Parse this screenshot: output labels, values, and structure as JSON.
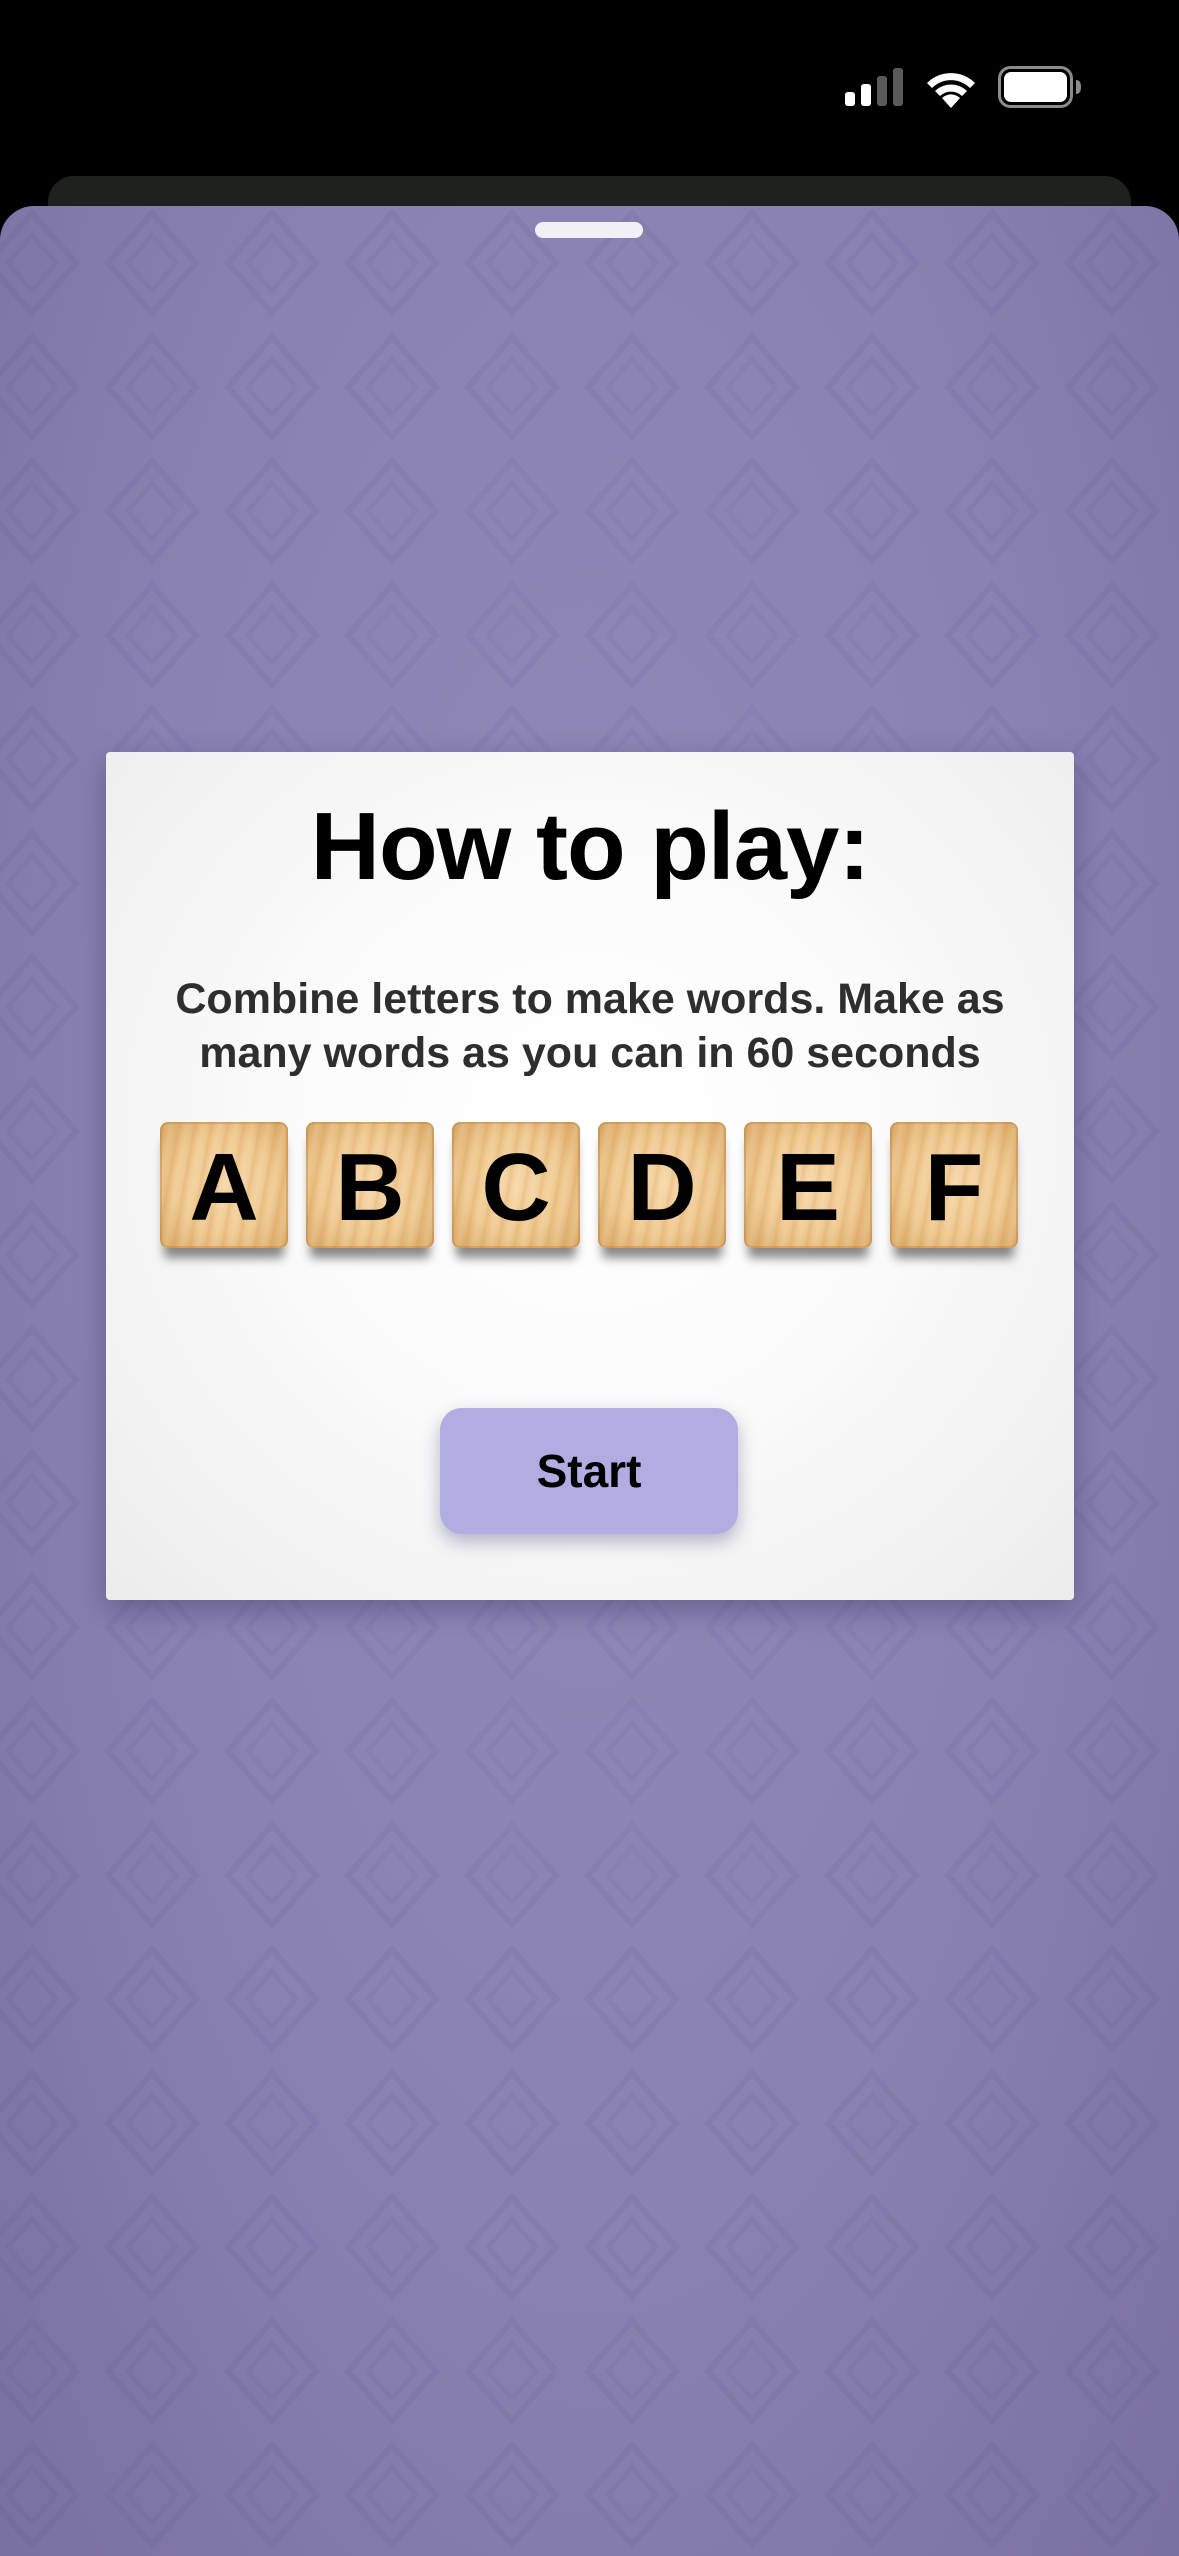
{
  "status_bar": {
    "signal_icon": "cellular-signal-icon",
    "wifi_icon": "wifi-icon",
    "battery_icon": "battery-icon"
  },
  "sheet": {
    "background_color": "#8a82b3",
    "grabber": "sheet-grabber"
  },
  "card": {
    "title": "How to play:",
    "description": "Combine letters to make words. Make as many words as you can in 60 seconds",
    "tiles": [
      "A",
      "B",
      "C",
      "D",
      "E",
      "F"
    ],
    "start_label": "Start",
    "start_button_color": "#b1ace2"
  }
}
